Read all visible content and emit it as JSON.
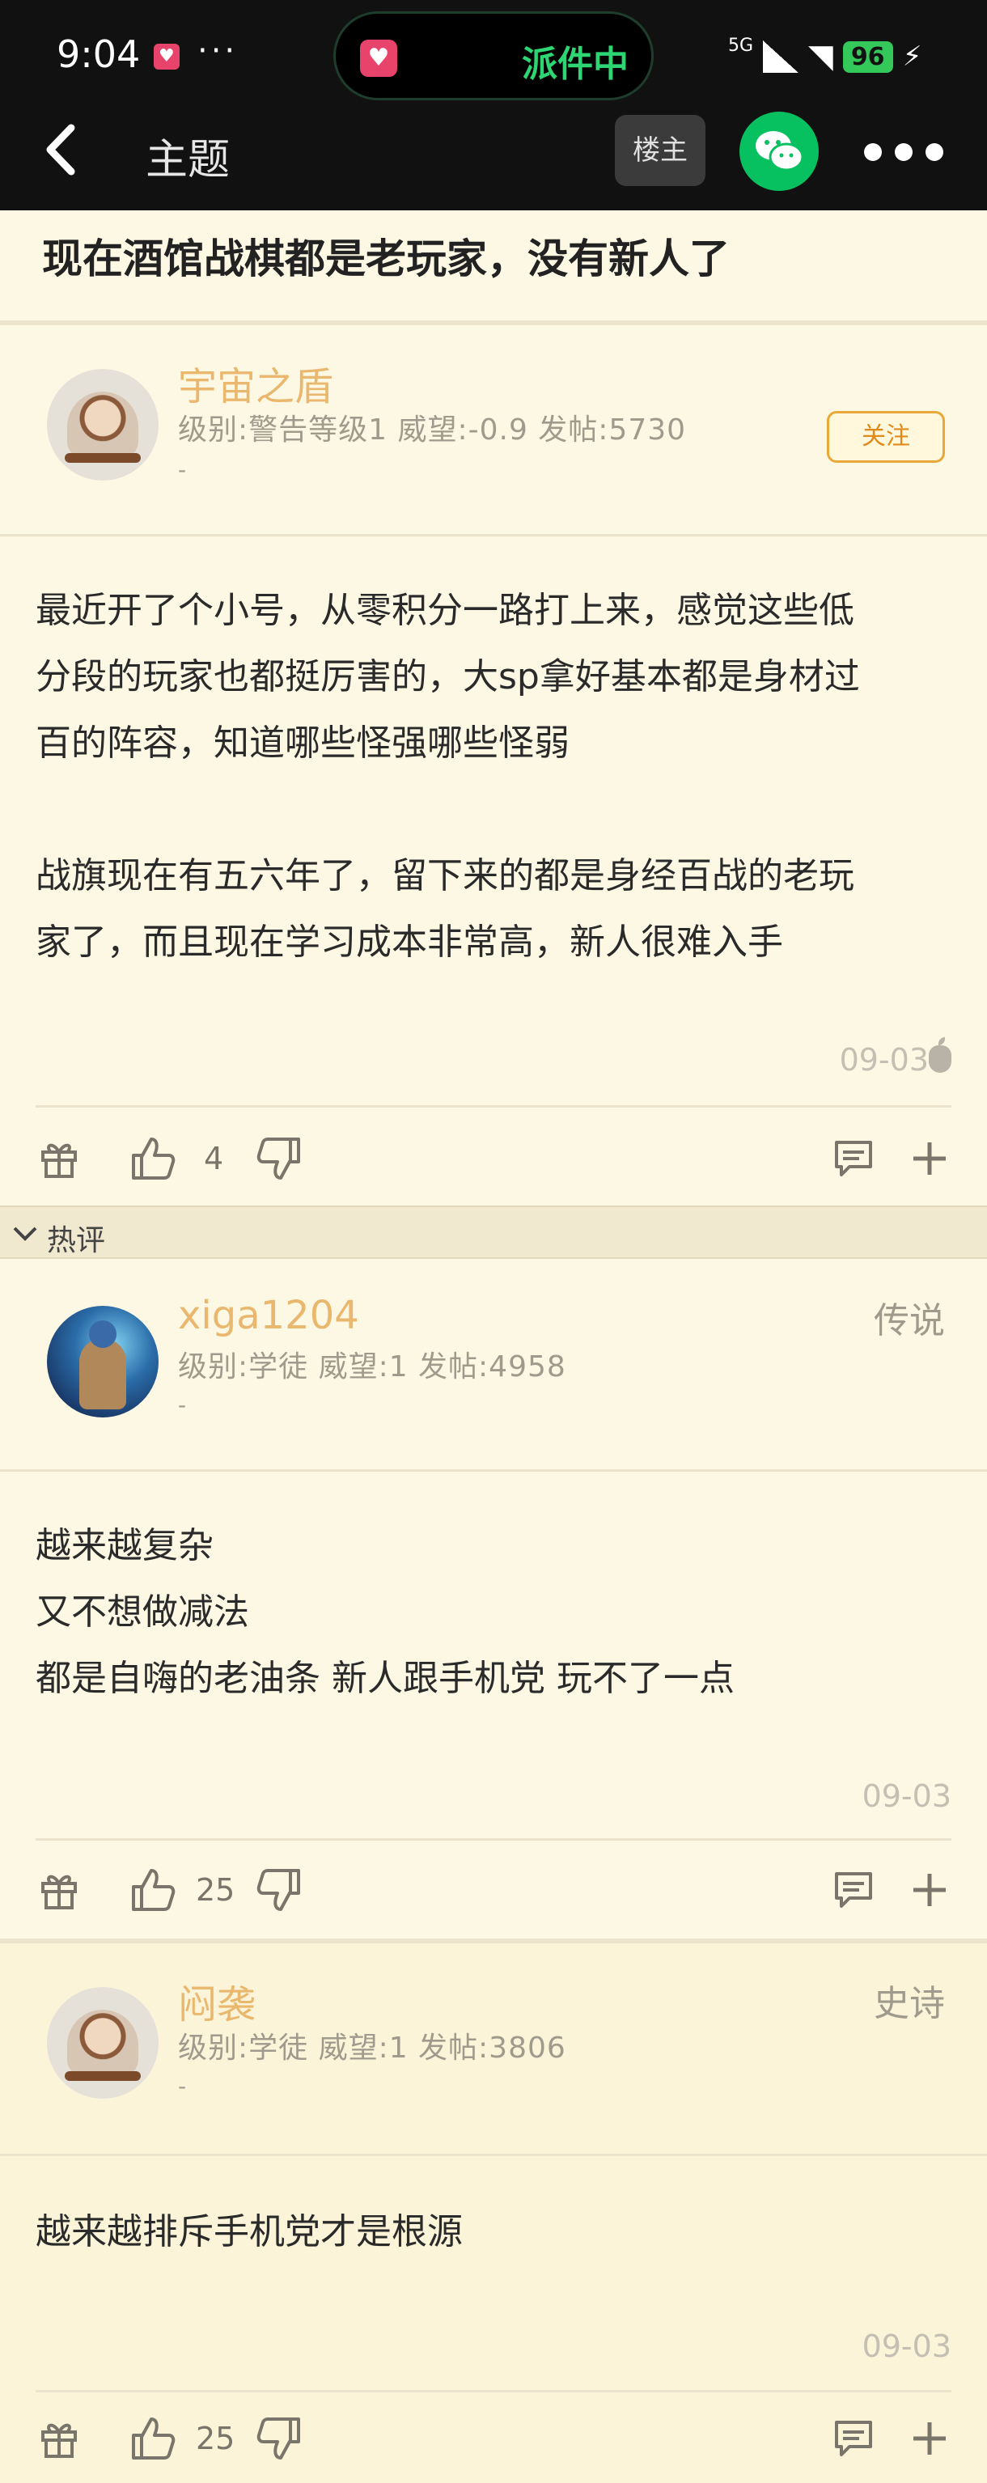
{
  "status_bar": {
    "time": "9:04",
    "dots": "···",
    "pill_text": "派件中",
    "network": "5G",
    "battery": "96"
  },
  "toolbar": {
    "title": "主题",
    "op_label": "楼主"
  },
  "thread": {
    "title": "现在酒馆战棋都是老玩家，没有新人了"
  },
  "posts": [
    {
      "username": "宇宙之盾",
      "meta": "级别:警告等级1 威望:-0.9 发帖:5730",
      "dash": "-",
      "follow_label": "关注",
      "body": [
        "最近开了个小号，从零积分一路打上来，感觉这些低",
        "分段的玩家也都挺厉害的，大sp拿好基本都是身材过",
        "百的阵容，知道哪些怪强哪些怪弱",
        "",
        "战旗现在有五六年了，留下来的都是身经百战的老玩",
        "家了，而且现在学习成本非常高，新人很难入手"
      ],
      "date": "09-03",
      "likes": "4"
    },
    {
      "username": "xiga1204",
      "meta": "级别:学徒 威望:1 发帖:4958",
      "dash": "-",
      "tier": "传说",
      "body": [
        "越来越复杂",
        "又不想做减法",
        "都是自嗨的老油条 新人跟手机党 玩不了一点"
      ],
      "date": "09-03",
      "likes": "25"
    },
    {
      "username": "闷袭",
      "meta": "级别:学徒 威望:1 发帖:3806",
      "dash": "-",
      "tier": "史诗",
      "body": [
        "越来越排斥手机党才是根源"
      ],
      "date": "09-03",
      "likes": "25"
    }
  ],
  "hot_section": {
    "label": "热评"
  }
}
